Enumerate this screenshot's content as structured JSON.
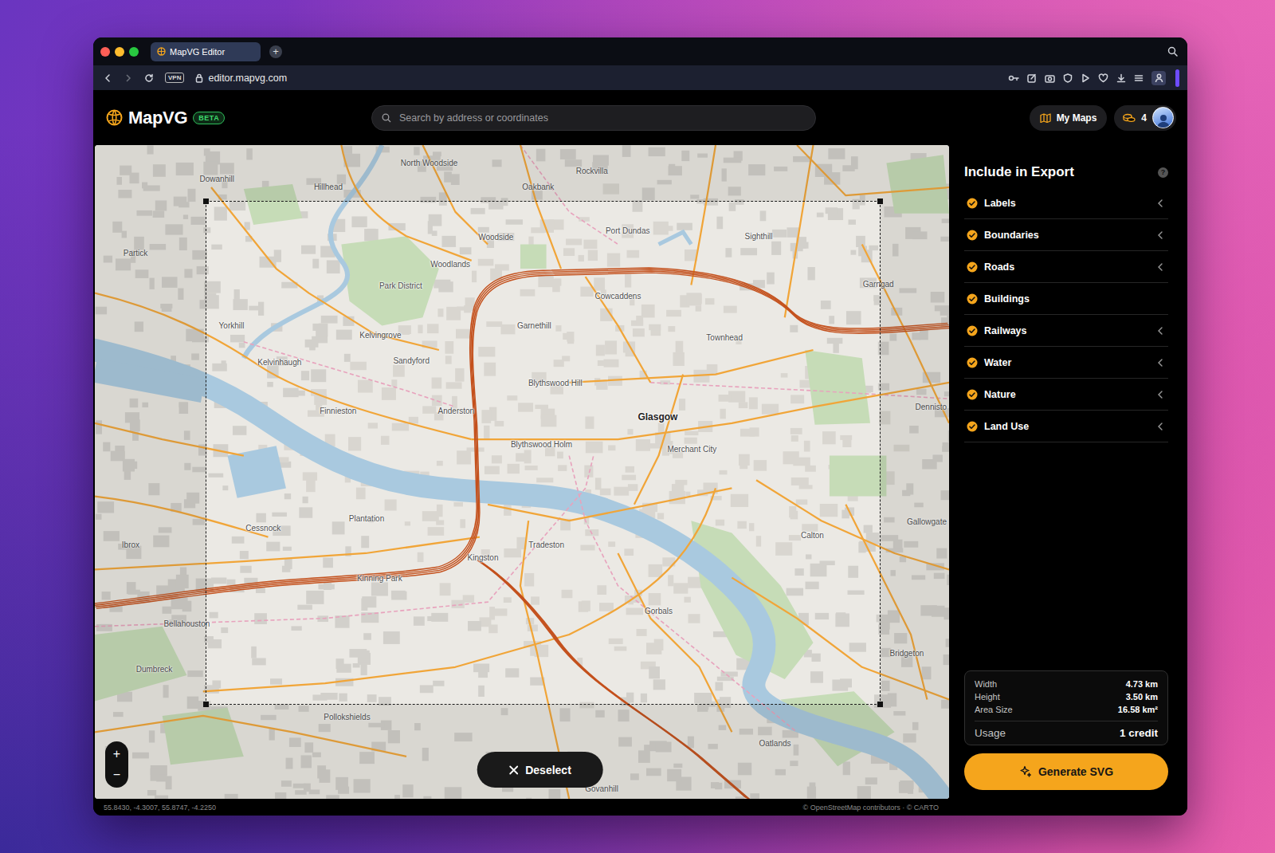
{
  "browser": {
    "tab": {
      "title": "MapVG Editor",
      "selected": true
    },
    "new_tab": "+",
    "vpn": "VPN",
    "url": "editor.mapvg.com"
  },
  "app": {
    "logo": "MapVG",
    "badge": "BETA",
    "search": {
      "placeholder": "Search by address or coordinates"
    },
    "my_maps": "My Maps",
    "credits": "4"
  },
  "map": {
    "labels": [
      {
        "text": "North Woodside",
        "kind": "district"
      },
      {
        "text": "Rockvilla",
        "kind": "district"
      },
      {
        "text": "Dowanhill",
        "kind": "district"
      },
      {
        "text": "Hillhead",
        "kind": "district"
      },
      {
        "text": "Oakbank",
        "kind": "district"
      },
      {
        "text": "Port Dundas",
        "kind": "district"
      },
      {
        "text": "Sighthill",
        "kind": "district"
      },
      {
        "text": "Woodside",
        "kind": "district"
      },
      {
        "text": "Partick",
        "kind": "district"
      },
      {
        "text": "Woodlands",
        "kind": "district"
      },
      {
        "text": "Garngad",
        "kind": "district"
      },
      {
        "text": "Park District",
        "kind": "district"
      },
      {
        "text": "Cowcaddens",
        "kind": "district"
      },
      {
        "text": "Yorkhill",
        "kind": "district"
      },
      {
        "text": "Garnethill",
        "kind": "district"
      },
      {
        "text": "Kelvingrove",
        "kind": "district"
      },
      {
        "text": "Townhead",
        "kind": "district"
      },
      {
        "text": "Sandyford",
        "kind": "district"
      },
      {
        "text": "Kelvinhaugh",
        "kind": "district"
      },
      {
        "text": "Blythswood Hill",
        "kind": "district"
      },
      {
        "text": "Dennisto",
        "kind": "district"
      },
      {
        "text": "Finnieston",
        "kind": "district"
      },
      {
        "text": "Anderston",
        "kind": "district"
      },
      {
        "text": "Glasgow",
        "kind": "city"
      },
      {
        "text": "Blythswood Holm",
        "kind": "district"
      },
      {
        "text": "Merchant City",
        "kind": "district"
      },
      {
        "text": "Plantation",
        "kind": "district"
      },
      {
        "text": "Gallowgate",
        "kind": "district"
      },
      {
        "text": "Cessnock",
        "kind": "district"
      },
      {
        "text": "Calton",
        "kind": "district"
      },
      {
        "text": "Ibrox",
        "kind": "district"
      },
      {
        "text": "Tradeston",
        "kind": "district"
      },
      {
        "text": "Kingston",
        "kind": "district"
      },
      {
        "text": "Kinning Park",
        "kind": "district"
      },
      {
        "text": "Gorbals",
        "kind": "district"
      },
      {
        "text": "Bellahouston",
        "kind": "district"
      },
      {
        "text": "Bridgeton",
        "kind": "district"
      },
      {
        "text": "Dumbreck",
        "kind": "district"
      },
      {
        "text": "Pollokshields",
        "kind": "district"
      },
      {
        "text": "Oatlands",
        "kind": "district"
      },
      {
        "text": "Govanhill",
        "kind": "district"
      }
    ],
    "selection": {
      "active": true
    },
    "zoom": {
      "in": "+",
      "out": "−"
    },
    "deselect": "Deselect"
  },
  "panel": {
    "title": "Include in Export",
    "help": "?",
    "items": [
      {
        "label": "Labels",
        "checked": true,
        "expandable": true
      },
      {
        "label": "Boundaries",
        "checked": true,
        "expandable": true
      },
      {
        "label": "Roads",
        "checked": true,
        "expandable": true
      },
      {
        "label": "Buildings",
        "checked": true,
        "expandable": false
      },
      {
        "label": "Railways",
        "checked": true,
        "expandable": true
      },
      {
        "label": "Water",
        "checked": true,
        "expandable": true
      },
      {
        "label": "Nature",
        "checked": true,
        "expandable": true
      },
      {
        "label": "Land Use",
        "checked": true,
        "expandable": true
      }
    ],
    "stats": [
      {
        "label": "Width",
        "value": "4.73 km"
      },
      {
        "label": "Height",
        "value": "3.50 km"
      },
      {
        "label": "Area Size",
        "value": "16.58 km²"
      }
    ],
    "usage": {
      "label": "Usage",
      "value": "1 credit"
    },
    "generate": "Generate SVG"
  },
  "status_bar": {
    "coordinates": "55.8430, -4.3007, 55.8747, -4.2250",
    "attribution": "© OpenStreetMap contributors · © CARTO"
  }
}
